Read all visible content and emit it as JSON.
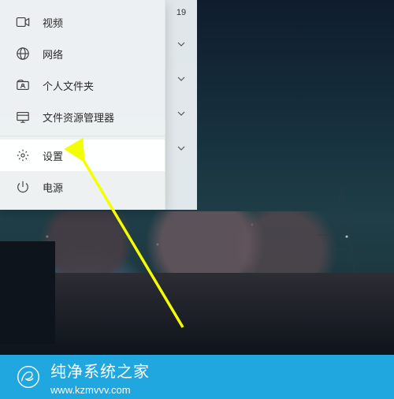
{
  "apps_header_fragment": "19",
  "start_menu": {
    "items": [
      {
        "key": "video",
        "label": "视频",
        "icon": "video-icon"
      },
      {
        "key": "network",
        "label": "网络",
        "icon": "network-icon"
      },
      {
        "key": "userfiles",
        "label": "个人文件夹",
        "icon": "user-folder-icon"
      },
      {
        "key": "explorer",
        "label": "文件资源管理器",
        "icon": "explorer-icon"
      },
      {
        "key": "settings",
        "label": "设置",
        "icon": "gear-icon",
        "hover": true
      },
      {
        "key": "power",
        "label": "电源",
        "icon": "power-icon"
      }
    ]
  },
  "watermark": {
    "site_name": "纯净系统之家",
    "url": "www.kzmvvv.com",
    "accent": "#21a7e0"
  }
}
